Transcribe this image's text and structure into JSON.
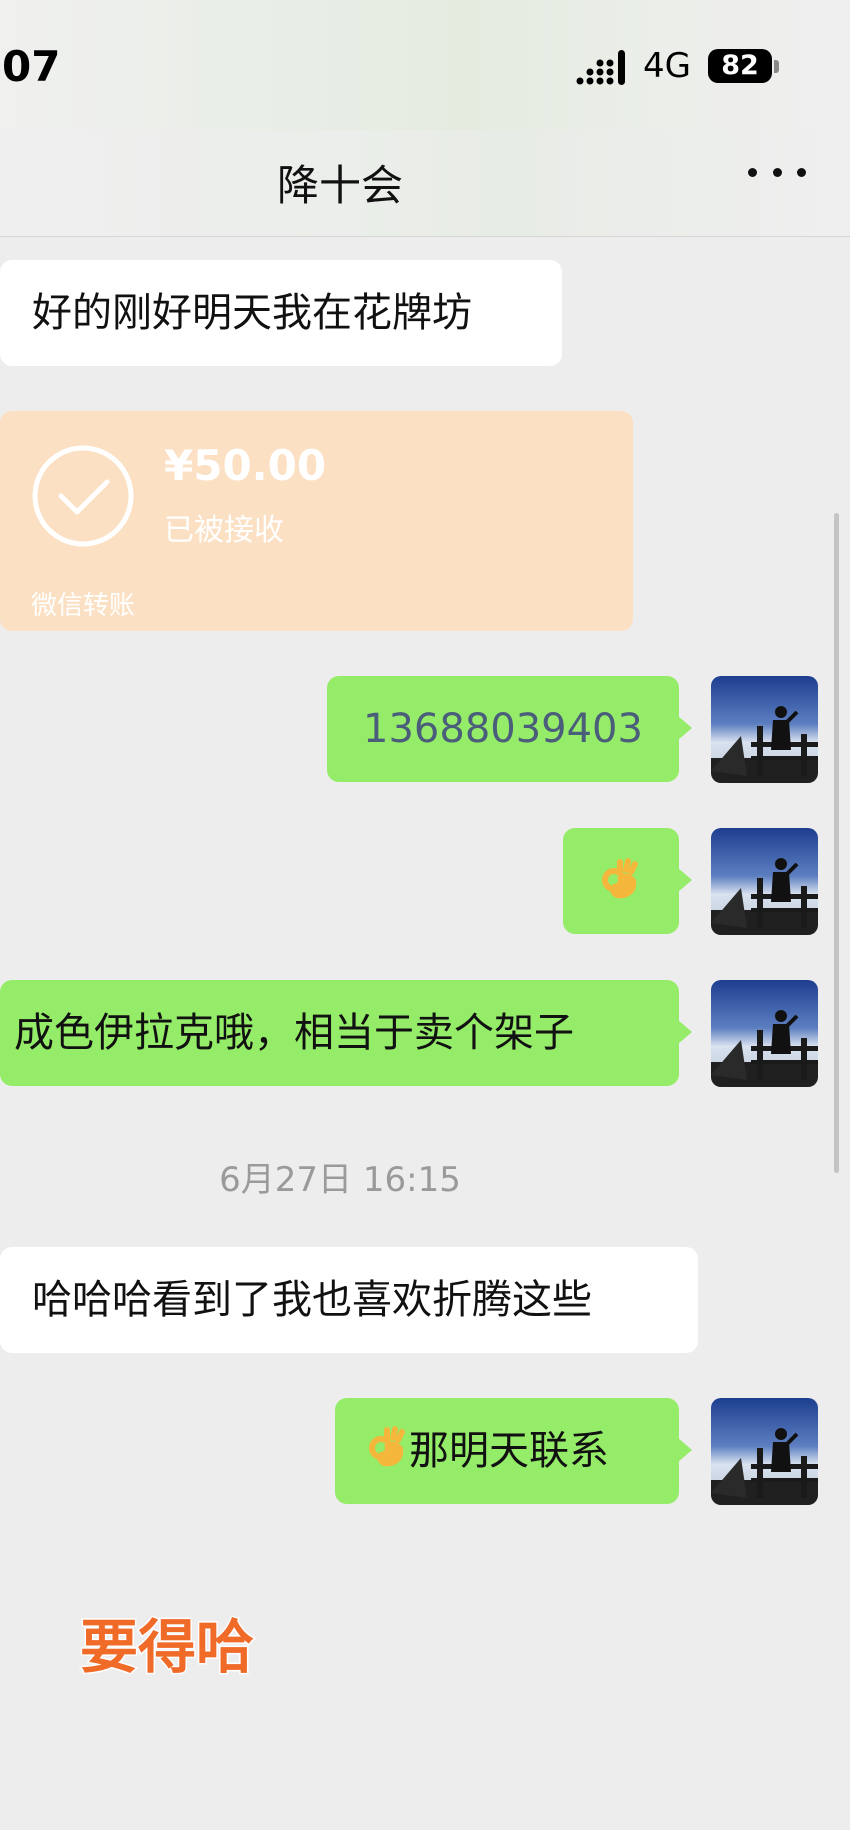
{
  "status_bar": {
    "time": "07",
    "network": "4G",
    "battery": "82"
  },
  "chat": {
    "title": "降十会"
  },
  "messages": [
    {
      "direction": "in",
      "type": "text",
      "text": "好的刚好明天我在花牌坊"
    },
    {
      "direction": "in",
      "type": "transfer",
      "amount": "¥50.00",
      "status": "已被接收",
      "label": "微信转账"
    },
    {
      "direction": "out",
      "type": "text",
      "text": "13688039403"
    },
    {
      "direction": "out",
      "type": "emoji",
      "emoji": "ok-hand"
    },
    {
      "direction": "out",
      "type": "text",
      "text": "成色伊拉克哦，相当于卖个架子"
    },
    {
      "type": "timestamp",
      "text": "6月27日 16:15"
    },
    {
      "direction": "in",
      "type": "text",
      "text": "哈哈哈看到了我也喜欢折腾这些"
    },
    {
      "direction": "out",
      "type": "text",
      "emoji": "ok-hand",
      "text": "那明天联系"
    }
  ],
  "sticker": {
    "text": "要得哈"
  },
  "colors": {
    "outgoing_bubble": "#95ec69",
    "incoming_bubble": "#ffffff",
    "transfer_card": "#fce0c4",
    "background": "#ededed"
  }
}
